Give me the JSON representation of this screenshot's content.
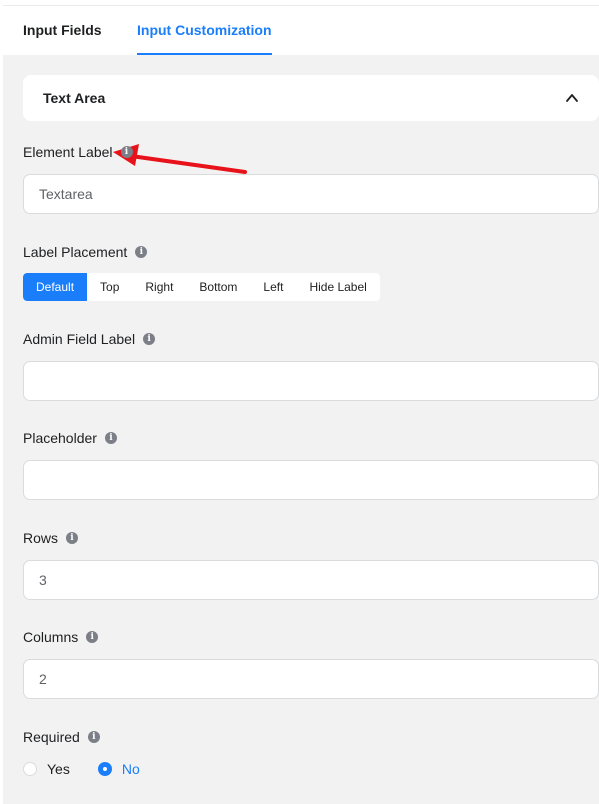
{
  "tabs": [
    {
      "label": "Input Fields",
      "active": false
    },
    {
      "label": "Input Customization",
      "active": true
    }
  ],
  "accordion": {
    "title": "Text Area",
    "icon": "chevron-up-icon"
  },
  "fields": {
    "element_label": {
      "label": "Element Label",
      "value": "Textarea",
      "placeholder": ""
    },
    "label_placement": {
      "label": "Label Placement",
      "options": [
        "Default",
        "Top",
        "Right",
        "Bottom",
        "Left",
        "Hide Label"
      ],
      "selected": "Default"
    },
    "admin_field_label": {
      "label": "Admin Field Label",
      "value": "",
      "placeholder": ""
    },
    "placeholder": {
      "label": "Placeholder",
      "value": "",
      "placeholder": ""
    },
    "rows": {
      "label": "Rows",
      "value": "3"
    },
    "columns": {
      "label": "Columns",
      "value": "2"
    },
    "required": {
      "label": "Required",
      "options": [
        "Yes",
        "No"
      ],
      "selected": "No"
    }
  },
  "info_icon": "i",
  "colors": {
    "accent": "#1a7efb",
    "annotation_arrow": "#e8121a",
    "panel_bg": "#f2f2f2"
  }
}
